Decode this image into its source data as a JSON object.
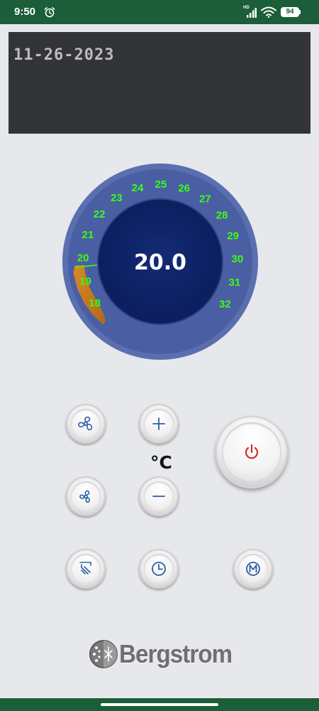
{
  "status_bar": {
    "time": "9:50",
    "network": "HD",
    "battery": "94"
  },
  "date": "11-26-2023",
  "dial": {
    "value": "20.0",
    "scale": [
      "18",
      "19",
      "20",
      "21",
      "22",
      "23",
      "24",
      "25",
      "26",
      "27",
      "28",
      "29",
      "30",
      "31",
      "32"
    ],
    "scale_min": 18,
    "scale_max": 32,
    "current": 20
  },
  "unit": "°C",
  "brand": "Bergstrom",
  "colors": {
    "status_bar": "#1b5e39",
    "dial_ring": "#4a5fa3",
    "dial_center": "#0f2468",
    "scale_text": "#39ff14",
    "power_icon": "#d32f2f",
    "button_icon": "#2d5ca8"
  },
  "icons": {
    "fan_speed": "fan-icon",
    "fan_mode": "fan-icon",
    "plus": "plus-icon",
    "minus": "minus-icon",
    "power": "power-icon",
    "airflow": "airflow-icon",
    "timer": "clock-icon",
    "mode": "mode-m-icon"
  }
}
